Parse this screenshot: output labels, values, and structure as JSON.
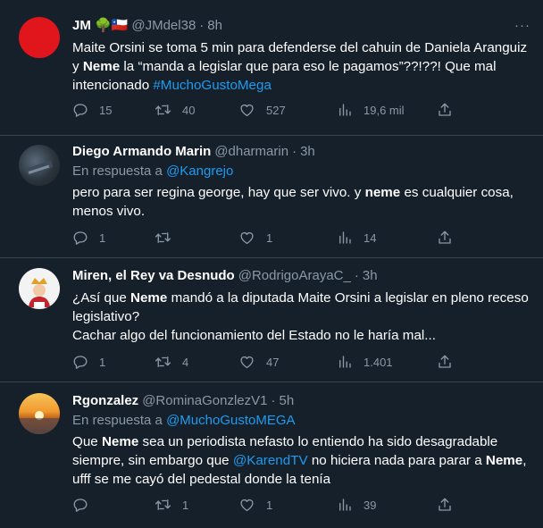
{
  "tweets": [
    {
      "name": "JM 🌳🇨🇱",
      "handle": "@JMdel38",
      "time": "8h",
      "text_parts": [
        "Maite Orsini se toma 5 min para defenderse del cahuin de Daniela Aranguiz y ",
        "Neme",
        " la “manda a legislar que para eso le pagamos”??!??! Que mal intencionado ",
        "#MuchoGustoMega"
      ],
      "replies": "15",
      "retweets": "40",
      "likes": "527",
      "views": "19,6 mil",
      "avatar_color": "#e0161c"
    },
    {
      "name": "Diego Armando Marin",
      "handle": "@dharmarin",
      "time": "3h",
      "reply_prefix": "En respuesta a ",
      "reply_to": "@Kangrejo",
      "text_parts": [
        "pero para ser regina george, hay que ser vivo. y ",
        "neme",
        " es cualquier cosa, menos vivo."
      ],
      "replies": "1",
      "retweets": "",
      "likes": "1",
      "views": "14"
    },
    {
      "name": "Miren, el Rey va Desnudo",
      "handle": "@RodrigoArayaC_",
      "time": "3h",
      "text_parts": [
        "¿Así que ",
        "Neme",
        " mandó a la diputada Maite Orsini a legislar en pleno receso legislativo?",
        "Cachar algo del funcionamiento del Estado no le haría mal..."
      ],
      "replies": "1",
      "retweets": "4",
      "likes": "47",
      "views": "1.401"
    },
    {
      "name": "Rgonzalez",
      "handle": "@RominaGonzlezV1",
      "time": "5h",
      "reply_prefix": "En respuesta a ",
      "reply_to": "@MuchoGustoMEGA",
      "text_parts": [
        "Que ",
        "Neme",
        " sea un periodista nefasto lo entiendo ha sido desagradable siempre, sin embargo que ",
        "@KarendTV",
        " no hiciera nada para parar a ",
        "Neme",
        ", ufff se me cayó del pedestal donde la tenía"
      ],
      "replies": "",
      "retweets": "1",
      "likes": "1",
      "views": "39"
    }
  ],
  "ui": {
    "dot": "·",
    "more": "···"
  },
  "colors": {
    "background": "#15202b",
    "link": "#1d9bf0",
    "muted": "#8b98a5",
    "divider": "#38444d"
  },
  "icons": [
    "reply-icon",
    "retweet-icon",
    "like-icon",
    "views-icon",
    "share-icon"
  ]
}
